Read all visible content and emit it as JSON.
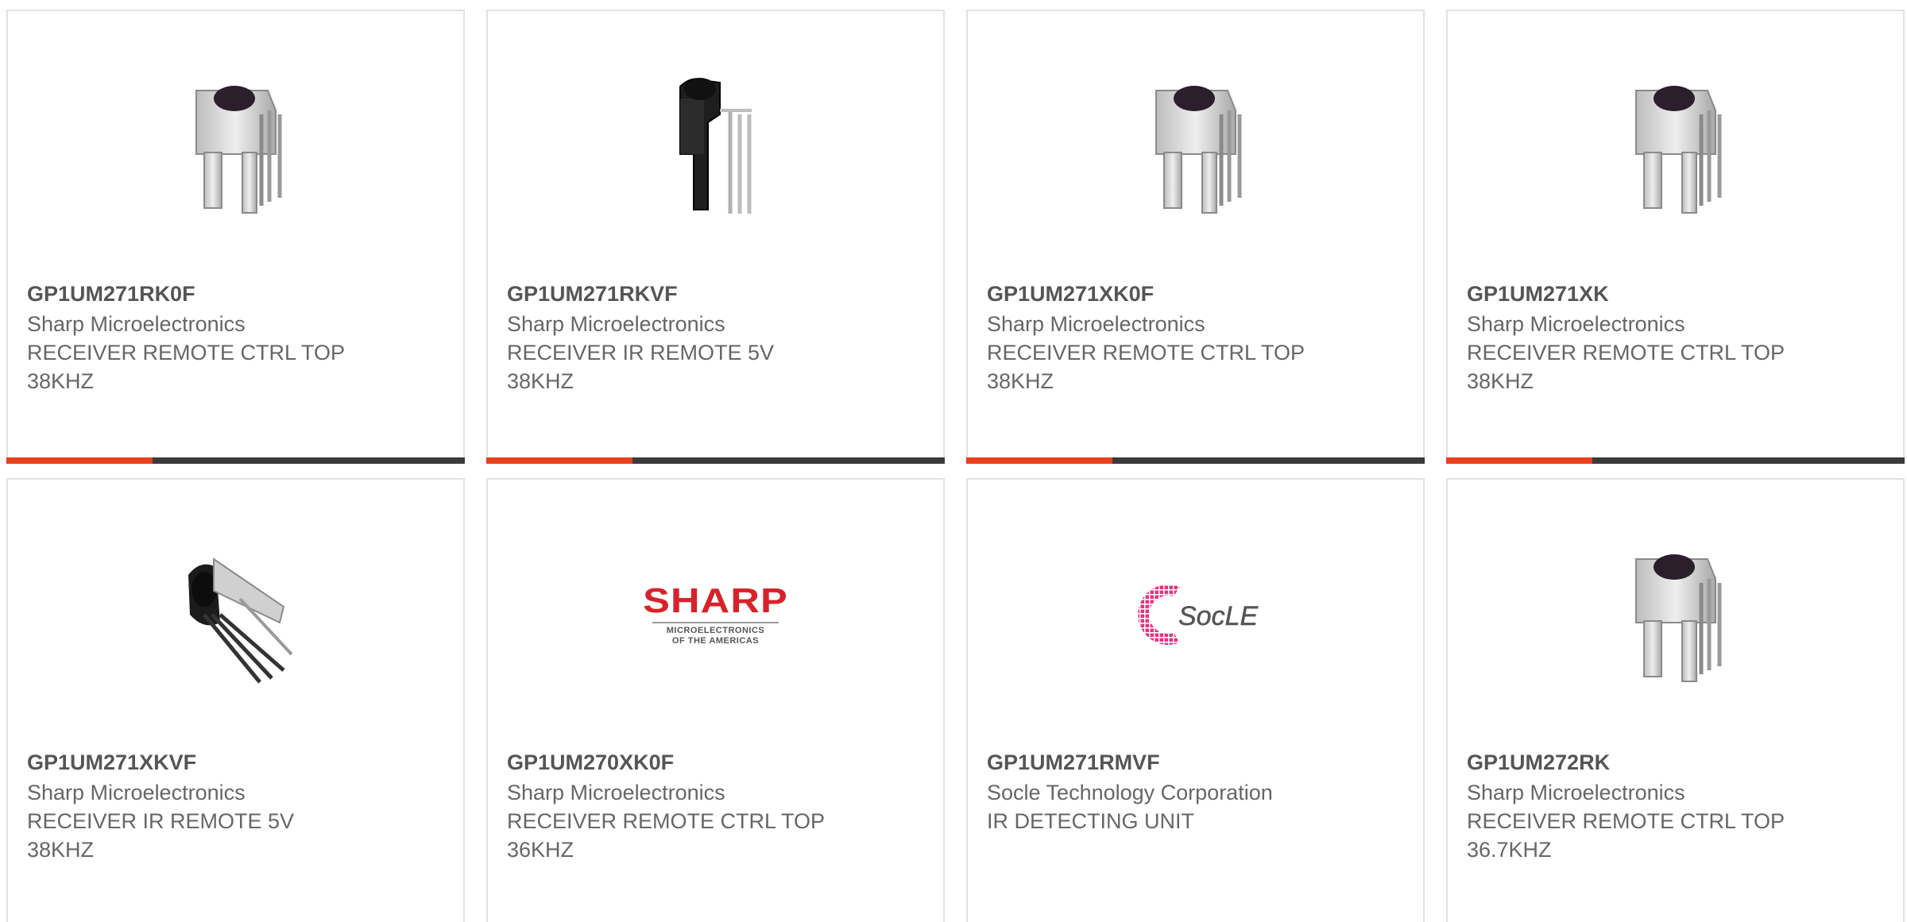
{
  "products": [
    {
      "part": "GP1UM271RK0F",
      "maker": "Sharp Microelectronics",
      "desc1": "RECEIVER REMOTE CTRL TOP",
      "desc2": "38KHZ",
      "image": "ir-receiver-silver-icon"
    },
    {
      "part": "GP1UM271RKVF",
      "maker": "Sharp Microelectronics",
      "desc1": "RECEIVER IR REMOTE 5V",
      "desc2": "38KHZ",
      "image": "ir-receiver-black-icon"
    },
    {
      "part": "GP1UM271XK0F",
      "maker": "Sharp Microelectronics",
      "desc1": "RECEIVER REMOTE CTRL TOP",
      "desc2": "38KHZ",
      "image": "ir-receiver-silver-icon"
    },
    {
      "part": "GP1UM271XK",
      "maker": "Sharp Microelectronics",
      "desc1": "RECEIVER REMOTE CTRL TOP",
      "desc2": "38KHZ",
      "image": "ir-receiver-silver-icon"
    },
    {
      "part": "GP1UM271XKVF",
      "maker": "Sharp Microelectronics",
      "desc1": "RECEIVER IR REMOTE 5V",
      "desc2": "38KHZ",
      "image": "ir-receiver-side-icon"
    },
    {
      "part": "GP1UM270XK0F",
      "maker": "Sharp Microelectronics",
      "desc1": "RECEIVER REMOTE CTRL TOP",
      "desc2": "36KHZ",
      "image": "sharp-logo"
    },
    {
      "part": "GP1UM271RMVF",
      "maker": "Socle Technology Corporation",
      "desc1": "IR DETECTING UNIT",
      "desc2": "",
      "image": "socle-logo"
    },
    {
      "part": "GP1UM272RK",
      "maker": "Sharp Microelectronics",
      "desc1": "RECEIVER REMOTE CTRL TOP",
      "desc2": "36.7KHZ",
      "image": "ir-receiver-silver-icon"
    }
  ],
  "logos": {
    "sharp": {
      "brand": "SHARP",
      "line1": "MICROELECTRONICS",
      "line2": "OF THE AMERICAS"
    },
    "socle": {
      "brand": "SocLE"
    }
  },
  "colors": {
    "accent": "#e8401c",
    "bar": "#3b3b3b",
    "sharp_red": "#d8222a",
    "socle_pink": "#e0357f"
  }
}
